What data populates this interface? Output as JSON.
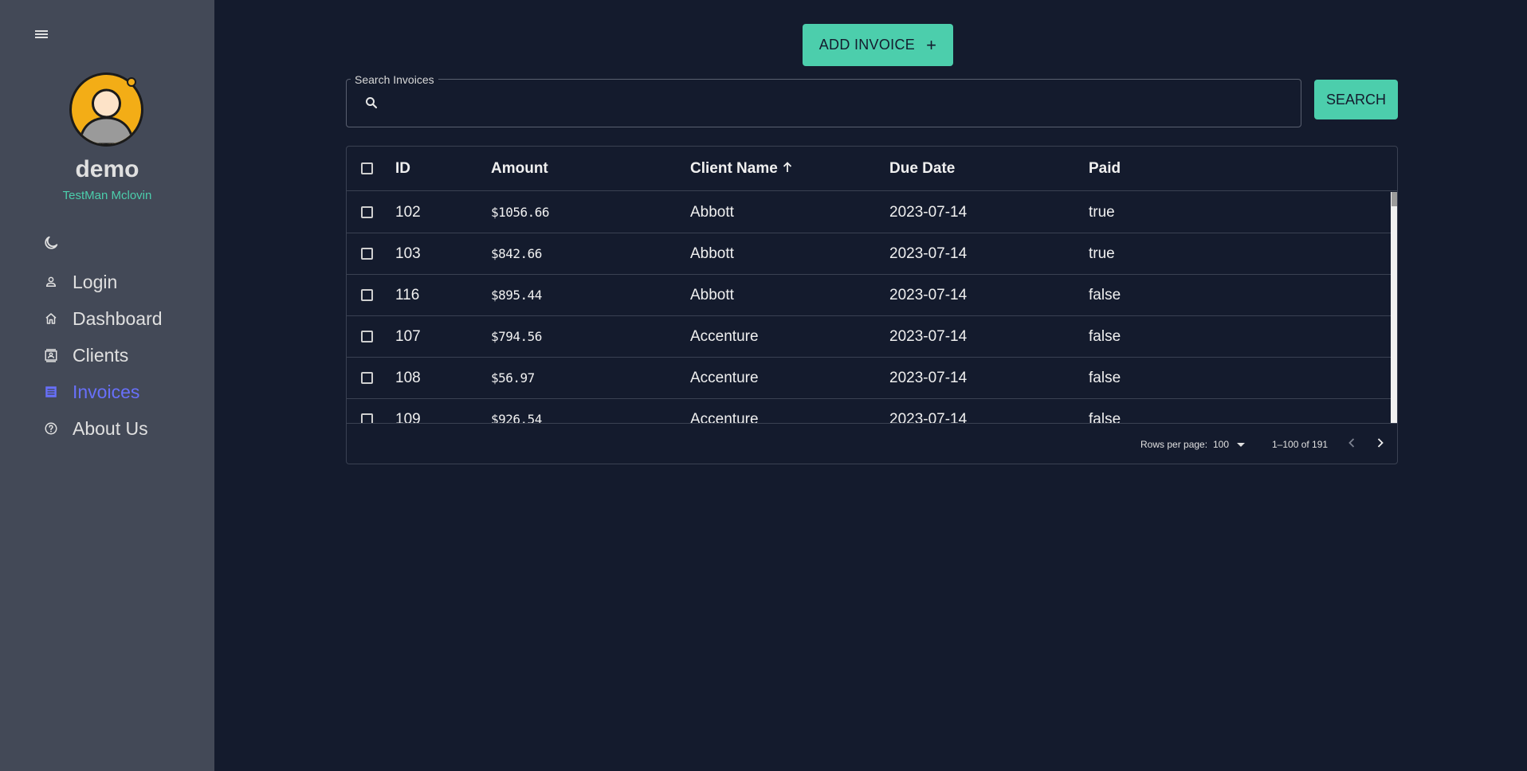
{
  "sidebar": {
    "user": {
      "name": "demo",
      "subtitle": "TestMan Mclovin"
    },
    "items": [
      {
        "label": "Login",
        "icon": "person-icon"
      },
      {
        "label": "Dashboard",
        "icon": "home-icon"
      },
      {
        "label": "Clients",
        "icon": "contacts-icon"
      },
      {
        "label": "Invoices",
        "icon": "receipt-icon",
        "active": true
      },
      {
        "label": "About Us",
        "icon": "help-circle-icon"
      }
    ]
  },
  "toolbar": {
    "add_label": "ADD INVOICE"
  },
  "search": {
    "legend": "Search Invoices",
    "value": "",
    "button_label": "SEARCH"
  },
  "grid": {
    "columns": {
      "id": "ID",
      "amount": "Amount",
      "client": "Client Name",
      "due": "Due Date",
      "paid": "Paid"
    },
    "sort": {
      "column": "client",
      "direction": "ascending"
    },
    "rows": [
      {
        "id": "102",
        "amount": "$1056.66",
        "client": "Abbott",
        "due": "2023-07-14",
        "paid": "true"
      },
      {
        "id": "103",
        "amount": "$842.66",
        "client": "Abbott",
        "due": "2023-07-14",
        "paid": "true"
      },
      {
        "id": "116",
        "amount": "$895.44",
        "client": "Abbott",
        "due": "2023-07-14",
        "paid": "false"
      },
      {
        "id": "107",
        "amount": "$794.56",
        "client": "Accenture",
        "due": "2023-07-14",
        "paid": "false"
      },
      {
        "id": "108",
        "amount": "$56.97",
        "client": "Accenture",
        "due": "2023-07-14",
        "paid": "false"
      },
      {
        "id": "109",
        "amount": "$926.54",
        "client": "Accenture",
        "due": "2023-07-14",
        "paid": "false"
      }
    ],
    "footer": {
      "rows_per_page_label": "Rows per page:",
      "rows_per_page": "100",
      "range": "1–100 of 191"
    }
  },
  "colors": {
    "background": "#141b2d",
    "sidebar": "#434957",
    "accent_green": "#4cceac",
    "active_nav": "#6870fa",
    "avatar": "#f3ad16"
  }
}
